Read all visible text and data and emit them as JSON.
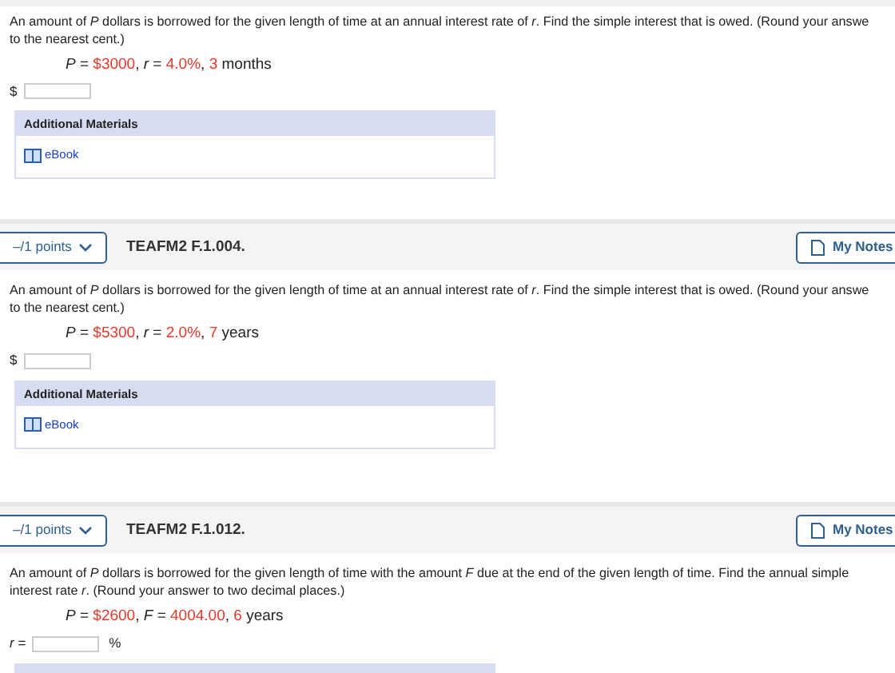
{
  "questions": [
    {
      "prompt_lines": [
        "An amount of *P* dollars is borrowed for the given length of time at an annual interest rate of *r*. Find the simple interest that is owed. (Round your answe",
        "to the nearest cent.)"
      ],
      "formula": [
        {
          "kind": "var",
          "text": "P"
        },
        {
          "kind": "plain",
          "text": " = "
        },
        {
          "kind": "value",
          "text": "$3000"
        },
        {
          "kind": "plain",
          "text": ", "
        },
        {
          "kind": "var",
          "text": "r"
        },
        {
          "kind": "plain",
          "text": " = "
        },
        {
          "kind": "value",
          "text": "4.0%"
        },
        {
          "kind": "plain",
          "text": ", "
        },
        {
          "kind": "value",
          "text": "3"
        },
        {
          "kind": "plain",
          "text": " months"
        }
      ],
      "answer": {
        "prefix": "$"
      },
      "materials": {
        "kind": "full",
        "title": "Additional Materials",
        "links": [
          "eBook"
        ]
      }
    },
    {
      "header": {
        "points": "–/1 points",
        "title": "TEAFM2 F.1.004.",
        "notes": "My Notes"
      },
      "prompt_lines": [
        "An amount of *P* dollars is borrowed for the given length of time at an annual interest rate of *r*. Find the simple interest that is owed. (Round your answe",
        "to the nearest cent.)"
      ],
      "formula": [
        {
          "kind": "var",
          "text": "P"
        },
        {
          "kind": "plain",
          "text": " = "
        },
        {
          "kind": "value",
          "text": "$5300"
        },
        {
          "kind": "plain",
          "text": ", "
        },
        {
          "kind": "var",
          "text": "r"
        },
        {
          "kind": "plain",
          "text": " = "
        },
        {
          "kind": "value",
          "text": "2.0%"
        },
        {
          "kind": "plain",
          "text": ", "
        },
        {
          "kind": "value",
          "text": "7"
        },
        {
          "kind": "plain",
          "text": " years"
        }
      ],
      "answer": {
        "prefix": "$"
      },
      "materials": {
        "kind": "full",
        "title": "Additional Materials",
        "links": [
          "eBook"
        ]
      }
    },
    {
      "header": {
        "points": "–/1 points",
        "title": "TEAFM2 F.1.012.",
        "notes": "My Notes"
      },
      "prompt_lines": [
        "An amount of *P* dollars is borrowed for the given length of time with the amount *F* due at the end of the given length of time. Find the annual simple",
        "interest rate *r*. (Round your answer to two decimal places.)"
      ],
      "formula": [
        {
          "kind": "var",
          "text": "P"
        },
        {
          "kind": "plain",
          "text": " = "
        },
        {
          "kind": "value",
          "text": "$2600"
        },
        {
          "kind": "plain",
          "text": ", "
        },
        {
          "kind": "var",
          "text": "F"
        },
        {
          "kind": "plain",
          "text": " = "
        },
        {
          "kind": "value",
          "text": "4004.00"
        },
        {
          "kind": "plain",
          "text": ", "
        },
        {
          "kind": "value",
          "text": "6"
        },
        {
          "kind": "plain",
          "text": " years"
        }
      ],
      "answer": {
        "prefix": "*r* =",
        "suffix": "%"
      },
      "materials": {
        "kind": "band"
      }
    }
  ]
}
